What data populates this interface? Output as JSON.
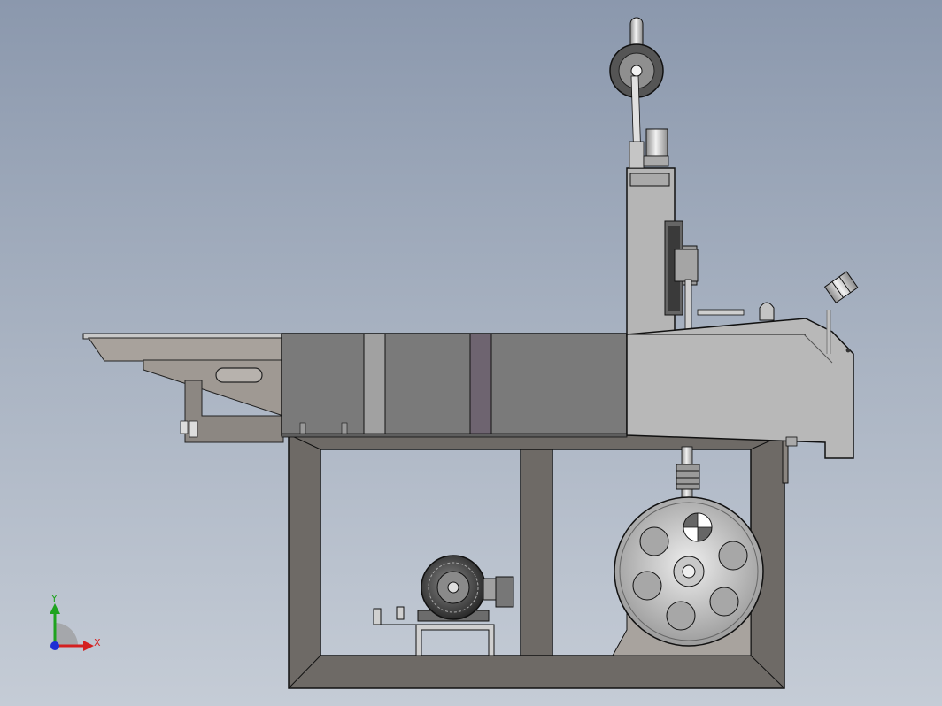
{
  "viewport": {
    "background_top": "#8b98ad",
    "background_bottom": "#c5ccd6"
  },
  "model": {
    "parts": [
      "frame",
      "infeed-table",
      "guard-panels",
      "cutting-head",
      "balance-wheel",
      "upper-handwheel",
      "drive-motor",
      "flywheel",
      "coolant-nozzle"
    ]
  },
  "triad": {
    "x_label": "X",
    "y_label": "Y",
    "x_color": "#d42020",
    "y_color": "#1fa31f",
    "z_color": "#1f2fd4"
  }
}
